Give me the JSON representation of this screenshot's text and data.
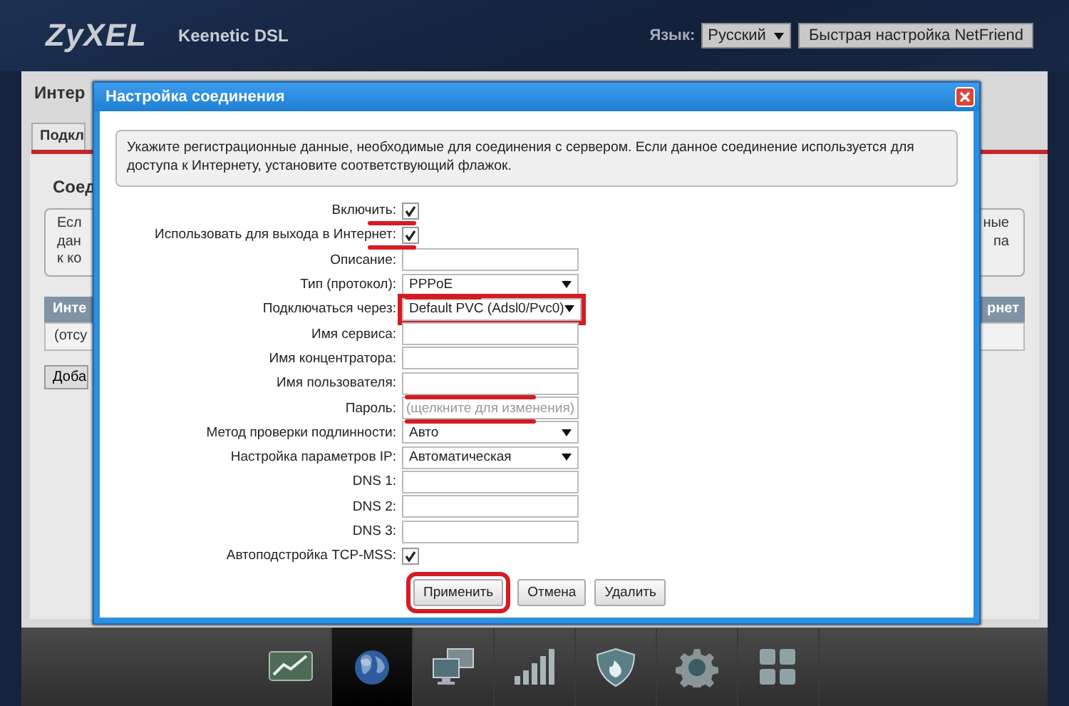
{
  "header": {
    "logo": "ZyXEL",
    "model": "Keenetic DSL",
    "language_label": "Язык:",
    "language": "Русский",
    "netfriend_button": "Быстрая настройка NetFriend"
  },
  "background_page": {
    "title": "Интер",
    "tab": "Подкл",
    "section_title": "Соед",
    "info_lines": [
      {
        "left": "Есл",
        "right": "ные"
      },
      {
        "left": "дан",
        "right": "па"
      },
      {
        "left": "к ко"
      }
    ],
    "table_header": {
      "left": "Инте",
      "right": "рнет"
    },
    "table_row": "(отсу",
    "add_button": "Доба"
  },
  "dialog": {
    "title": "Настройка соединения",
    "info": "Укажите регистрационные данные, необходимые для соединения с сервером. Если данное соединение используется для доступа к Интернету, установите соответствующий флажок.",
    "fields": [
      {
        "kind": "checkbox",
        "label": "Включить:",
        "checked": true,
        "label_underlined": true
      },
      {
        "kind": "checkbox",
        "label": "Использовать для выхода в Интернет:",
        "checked": true,
        "label_underlined": true
      },
      {
        "kind": "text",
        "label": "Описание:"
      },
      {
        "kind": "select",
        "label": "Тип (протокол):",
        "value": "PPPoE",
        "value_underlined": true
      },
      {
        "kind": "select",
        "label": "Подключаться через:",
        "value": "Default PVC (Adsl0/Pvc0)",
        "boxed": true
      },
      {
        "kind": "text",
        "label": "Имя сервиса:"
      },
      {
        "kind": "text",
        "label": "Имя концентратора:"
      },
      {
        "kind": "text",
        "label": "Имя пользователя:",
        "value_underlined": true
      },
      {
        "kind": "text",
        "label": "Пароль:",
        "placeholder": "(щелкните для изменения)",
        "value_underlined": true
      },
      {
        "kind": "select",
        "label": "Метод проверки подлинности:",
        "value": "Авто"
      },
      {
        "kind": "select",
        "label": "Настройка параметров IP:",
        "value": "Автоматическая"
      },
      {
        "kind": "text",
        "label": "DNS 1:"
      },
      {
        "kind": "text",
        "label": "DNS 2:"
      },
      {
        "kind": "text",
        "label": "DNS 3:"
      },
      {
        "kind": "checkbox",
        "label": "Автоподстройка TCP-MSS:",
        "checked": true
      }
    ],
    "buttons": [
      {
        "label": "Применить",
        "boxed": true
      },
      {
        "label": "Отмена"
      },
      {
        "label": "Удалить"
      }
    ]
  },
  "nav": [
    {
      "kind": "chart",
      "selected": false
    },
    {
      "kind": "globe",
      "selected": true
    },
    {
      "kind": "computers",
      "selected": false
    },
    {
      "kind": "signal",
      "selected": false
    },
    {
      "kind": "shield",
      "selected": false
    },
    {
      "kind": "gear",
      "selected": false
    },
    {
      "kind": "grid",
      "selected": false
    }
  ]
}
